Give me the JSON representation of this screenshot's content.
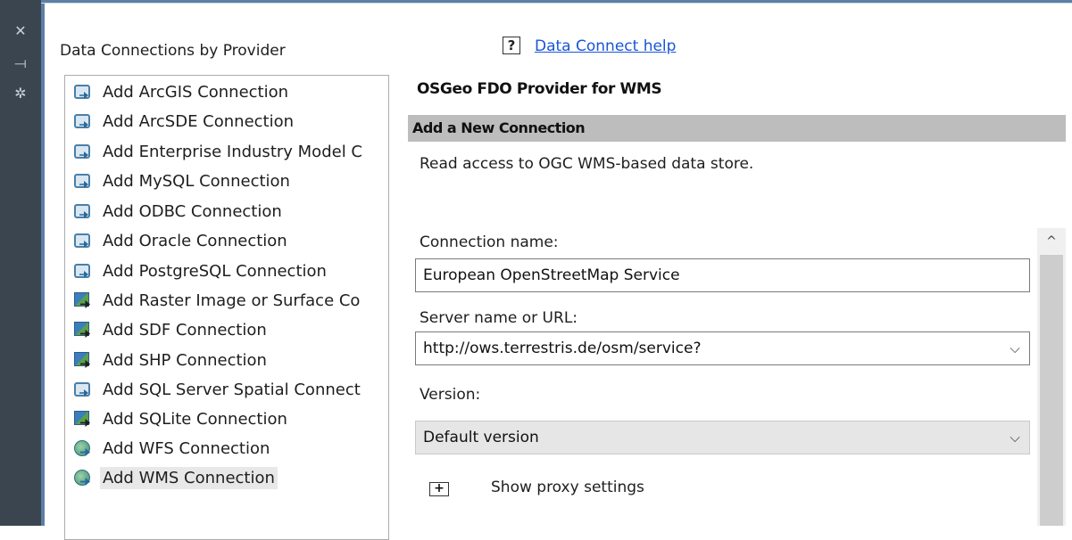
{
  "sidebar_icons": [
    "close-icon",
    "pin-icon",
    "settings-icon"
  ],
  "sidebar_glyphs": [
    "✕",
    "⟞",
    "✲"
  ],
  "panel": {
    "title": "Data Connections by Provider"
  },
  "providers": [
    {
      "label": "Add ArcGIS Connection",
      "icon": "db"
    },
    {
      "label": "Add ArcSDE Connection",
      "icon": "db"
    },
    {
      "label": "Add Enterprise Industry Model C",
      "icon": "db"
    },
    {
      "label": "Add MySQL Connection",
      "icon": "db"
    },
    {
      "label": "Add ODBC Connection",
      "icon": "db"
    },
    {
      "label": "Add Oracle Connection",
      "icon": "db"
    },
    {
      "label": "Add PostgreSQL Connection",
      "icon": "db"
    },
    {
      "label": "Add Raster Image or Surface Co",
      "icon": "raster"
    },
    {
      "label": "Add SDF Connection",
      "icon": "raster"
    },
    {
      "label": "Add SHP Connection",
      "icon": "raster"
    },
    {
      "label": "Add SQL Server Spatial Connect",
      "icon": "db"
    },
    {
      "label": "Add SQLite Connection",
      "icon": "raster"
    },
    {
      "label": "Add WFS Connection",
      "icon": "globe"
    },
    {
      "label": "Add WMS Connection",
      "icon": "globe",
      "selected": true
    }
  ],
  "help": {
    "icon_glyph": "?",
    "link": "Data Connect help"
  },
  "provider_name": "OSGeo FDO Provider for WMS",
  "section_title": "Add a New Connection",
  "description": "Read access to OGC WMS-based data store.",
  "form": {
    "connection_name_label": "Connection name:",
    "connection_name_value": "European OpenStreetMap Service",
    "server_label": "Server name or URL:",
    "server_value": "http://ows.terrestris.de/osm/service?",
    "version_label": "Version:",
    "version_value": "Default version",
    "proxy_label": "Show proxy settings",
    "proxy_glyph": "+"
  },
  "glyphs": {
    "dropdown": "⌵",
    "scroll_up": "^"
  }
}
